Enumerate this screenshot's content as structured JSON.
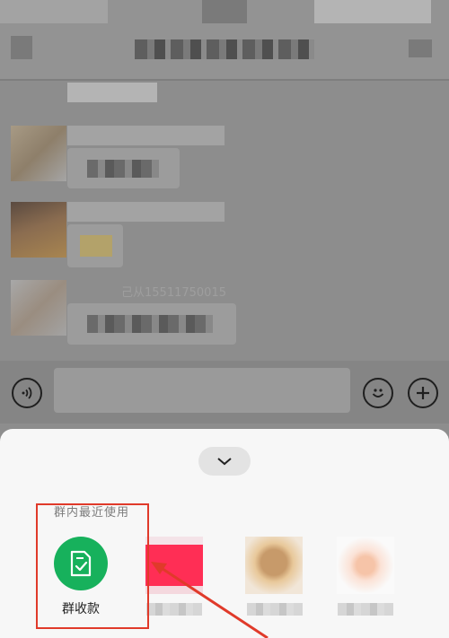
{
  "chat": {
    "partial_text": "己从15511750015"
  },
  "input_bar": {
    "voice_icon": "voice-icon",
    "emoji_icon": "emoji-icon",
    "add_icon": "plus-icon"
  },
  "sheet": {
    "collapse_icon": "chevron-down-icon",
    "section_label": "群内最近使用",
    "apps": [
      {
        "label": "群收款",
        "icon": "receipt-check-icon",
        "color": "#17b15c"
      }
    ],
    "highlight_color": "#e03a2a"
  }
}
